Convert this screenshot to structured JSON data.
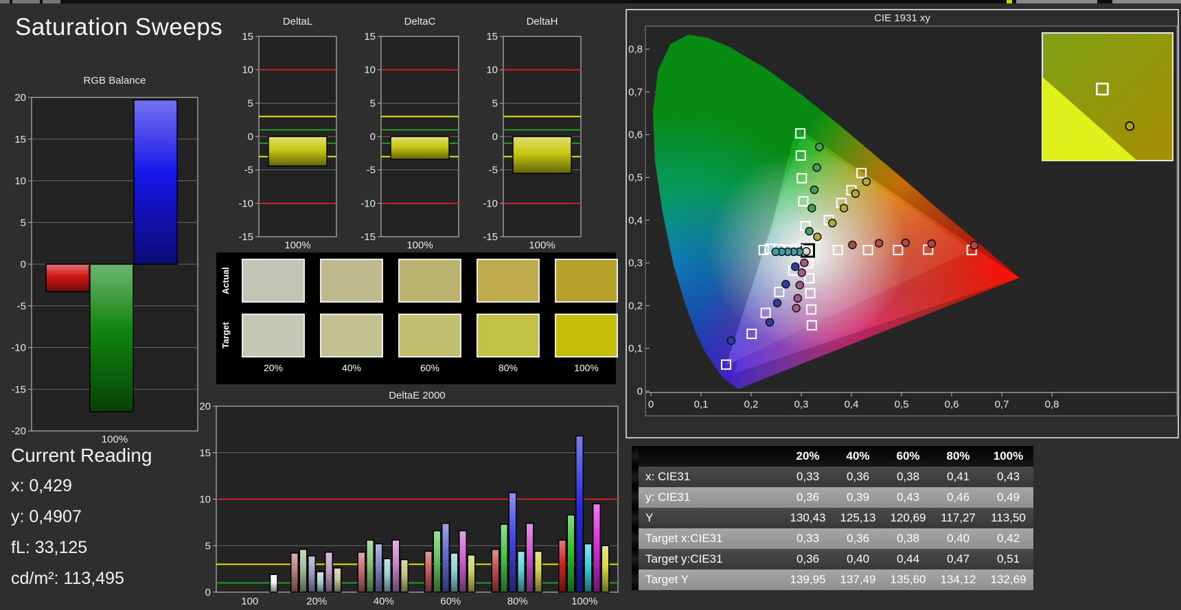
{
  "page": {
    "title": "Saturation Sweeps"
  },
  "current_reading": {
    "title": "Current Reading",
    "lines": [
      "x: 0,429",
      "y: 0,4907",
      "fL: 33,125",
      "cd/m²: 113,495"
    ]
  },
  "swatches": {
    "row_labels": [
      "Actual",
      "Target"
    ],
    "col_labels": [
      "20%",
      "40%",
      "60%",
      "80%",
      "100%"
    ],
    "actual": [
      "#c4c4b4",
      "#bfba8e",
      "#bdb370",
      "#bdab4c",
      "#b7a22c"
    ],
    "target": [
      "#c7c7b5",
      "#c2c190",
      "#c2bf6e",
      "#c2c144",
      "#c5be09"
    ]
  },
  "table": {
    "headers": [
      "20%",
      "40%",
      "60%",
      "80%",
      "100%"
    ],
    "rows": [
      {
        "label": "x: CIE31",
        "values": [
          "0,33",
          "0,36",
          "0,38",
          "0,41",
          "0,43"
        ]
      },
      {
        "label": "y: CIE31",
        "values": [
          "0,36",
          "0,39",
          "0,43",
          "0,46",
          "0,49"
        ]
      },
      {
        "label": "Y",
        "values": [
          "130,43",
          "125,13",
          "120,69",
          "117,27",
          "113,50"
        ]
      },
      {
        "label": "Target x:CIE31",
        "values": [
          "0,33",
          "0,36",
          "0,38",
          "0,40",
          "0,42"
        ]
      },
      {
        "label": "Target y:CIE31",
        "values": [
          "0,36",
          "0,40",
          "0,44",
          "0,47",
          "0,51"
        ]
      },
      {
        "label": "Target Y",
        "values": [
          "139,95",
          "137,49",
          "135,60",
          "134,12",
          "132,69"
        ]
      }
    ]
  },
  "chart_data": {
    "rgb_balance": {
      "type": "bar",
      "title": "RGB Balance",
      "category": "100%",
      "ylim": [
        -20,
        20
      ],
      "ystep": 5,
      "series": [
        {
          "name": "red",
          "value": -3.3,
          "color": "#d41414"
        },
        {
          "name": "green",
          "value": -17.7,
          "color": "#0f840f"
        },
        {
          "name": "blue",
          "value": 19.7,
          "color": "#1616e8"
        }
      ]
    },
    "delta_meters": {
      "type": "bar",
      "ylim": [
        -15,
        15
      ],
      "ystep": 5,
      "bar_color": "#c8c814",
      "ref_lines": [
        {
          "value": 10,
          "color": "#d42222"
        },
        {
          "value": -10,
          "color": "#d42222"
        },
        {
          "value": 3,
          "color": "#e6e600"
        },
        {
          "value": -3,
          "color": "#e6e600"
        },
        {
          "value": 1,
          "color": "#22a022"
        },
        {
          "value": -1,
          "color": "#22a022"
        }
      ],
      "charts": [
        {
          "title": "DeltaL",
          "category": "100%",
          "value": -4.4
        },
        {
          "title": "DeltaC",
          "category": "100%",
          "value": -3.4
        },
        {
          "title": "DeltaH",
          "category": "100%",
          "value": -5.5
        }
      ]
    },
    "deltae2000": {
      "type": "grouped-bar",
      "title": "DeltaE 2000",
      "ylim": [
        0,
        20
      ],
      "ystep": 5,
      "ref_lines": [
        {
          "value": 10,
          "color": "#d42222"
        },
        {
          "value": 3,
          "color": "#e6e600"
        },
        {
          "value": 1,
          "color": "#22a022"
        }
      ],
      "groups": [
        {
          "label": "100",
          "values": [
            1.9
          ],
          "colors": [
            "#f2f2f2"
          ]
        },
        {
          "label": "20%",
          "values": [
            4.2,
            4.6,
            3.9,
            2.2,
            4.3,
            2.6
          ],
          "colors": [
            "#b87e7e",
            "#a3bd94",
            "#9aa0cb",
            "#aed2d4",
            "#c09cc5",
            "#c6c69e"
          ]
        },
        {
          "label": "40%",
          "values": [
            4.3,
            5.6,
            5.2,
            3.6,
            5.6,
            3.5
          ],
          "colors": [
            "#c26f6f",
            "#84c276",
            "#7e86cc",
            "#9ed2d5",
            "#c987cd",
            "#c3c381"
          ]
        },
        {
          "label": "60%",
          "values": [
            4.4,
            6.6,
            7.4,
            4.2,
            6.6,
            4.0
          ],
          "colors": [
            "#c85d5d",
            "#64c364",
            "#6169d1",
            "#84d6d9",
            "#d064d4",
            "#cdcd6b"
          ]
        },
        {
          "label": "80%",
          "values": [
            4.6,
            7.3,
            10.7,
            4.4,
            7.4,
            4.4
          ],
          "colors": [
            "#c94b4b",
            "#47c947",
            "#4547d8",
            "#5cd3d8",
            "#d94bd9",
            "#d2d253"
          ]
        },
        {
          "label": "100%",
          "values": [
            5.6,
            8.3,
            16.8,
            5.2,
            9.5,
            5.0
          ],
          "colors": [
            "#cf2323",
            "#28c828",
            "#2a2ae0",
            "#3cd2da",
            "#dd2cdd",
            "#d8d838"
          ]
        }
      ]
    },
    "cie": {
      "type": "scatter",
      "title": "CIE 1931 xy",
      "xticks": [
        "0",
        "0,1",
        "0,2",
        "0,3",
        "0,4",
        "0,5",
        "0,6",
        "0,7",
        "0,8"
      ],
      "yticks": [
        "0",
        "0,1",
        "0,2",
        "0,3",
        "0,4",
        "0,5",
        "0,6",
        "0,7",
        "0,8"
      ],
      "xlim": [
        0,
        0.8
      ],
      "ylim": [
        0,
        0.85
      ],
      "gamut_native": [
        [
          0.29,
          0.617
        ],
        [
          0.734,
          0.265
        ],
        [
          0.167,
          0.042
        ]
      ],
      "gamut_ref": [
        [
          0.3,
          0.6
        ],
        [
          0.64,
          0.33
        ],
        [
          0.15,
          0.06
        ]
      ],
      "sweeps": [
        {
          "name": "white",
          "color": "#d9d9d9",
          "targets": [
            [
              0.313,
              0.329
            ]
          ],
          "measured": [
            [
              0.31,
              0.327
            ]
          ]
        },
        {
          "name": "red",
          "color": "#b04848",
          "targets": [
            [
              0.373,
              0.33
            ],
            [
              0.433,
              0.33
            ],
            [
              0.493,
              0.33
            ],
            [
              0.553,
              0.331
            ],
            [
              0.64,
              0.33
            ]
          ],
          "measured": [
            [
              0.402,
              0.342
            ],
            [
              0.455,
              0.346
            ],
            [
              0.508,
              0.347
            ],
            [
              0.56,
              0.345
            ],
            [
              0.645,
              0.341
            ]
          ]
        },
        {
          "name": "green",
          "color": "#44a258",
          "targets": [
            [
              0.308,
              0.386
            ],
            [
              0.304,
              0.444
            ],
            [
              0.301,
              0.498
            ],
            [
              0.299,
              0.551
            ],
            [
              0.298,
              0.603
            ]
          ],
          "measured": [
            [
              0.316,
              0.374
            ],
            [
              0.321,
              0.428
            ],
            [
              0.326,
              0.471
            ],
            [
              0.331,
              0.523
            ],
            [
              0.336,
              0.571
            ]
          ]
        },
        {
          "name": "blue",
          "color": "#2c3fa0",
          "targets": [
            [
              0.284,
              0.282
            ],
            [
              0.256,
              0.232
            ],
            [
              0.229,
              0.183
            ],
            [
              0.201,
              0.134
            ],
            [
              0.15,
              0.062
            ]
          ],
          "measured": [
            [
              0.288,
              0.291
            ],
            [
              0.269,
              0.25
            ],
            [
              0.252,
              0.206
            ],
            [
              0.237,
              0.161
            ],
            [
              0.16,
              0.118
            ]
          ]
        },
        {
          "name": "cyan",
          "color": "#3f9fa6",
          "targets": [
            [
              0.294,
              0.331
            ],
            [
              0.275,
              0.331
            ],
            [
              0.256,
              0.332
            ],
            [
              0.237,
              0.333
            ],
            [
              0.225,
              0.33
            ]
          ],
          "measured": [
            [
              0.296,
              0.326
            ],
            [
              0.285,
              0.326
            ],
            [
              0.273,
              0.326
            ],
            [
              0.261,
              0.326
            ],
            [
              0.249,
              0.326
            ]
          ]
        },
        {
          "name": "magenta",
          "color": "#a65a88",
          "targets": [
            [
              0.314,
              0.299
            ],
            [
              0.316,
              0.264
            ],
            [
              0.318,
              0.229
            ],
            [
              0.32,
              0.191
            ],
            [
              0.321,
              0.154
            ]
          ],
          "measured": [
            [
              0.306,
              0.3
            ],
            [
              0.301,
              0.277
            ],
            [
              0.297,
              0.248
            ],
            [
              0.293,
              0.217
            ],
            [
              0.29,
              0.194
            ]
          ]
        },
        {
          "name": "yellow",
          "color": "#b2a83e",
          "targets": [
            [
              0.33,
              0.36
            ],
            [
              0.355,
              0.4
            ],
            [
              0.38,
              0.44
            ],
            [
              0.4,
              0.47
            ],
            [
              0.42,
              0.51
            ]
          ],
          "measured": [
            [
              0.332,
              0.361
            ],
            [
              0.362,
              0.393
            ],
            [
              0.385,
              0.428
            ],
            [
              0.408,
              0.462
            ],
            [
              0.43,
              0.49
            ]
          ]
        }
      ],
      "inset": {
        "square": [
          0.46,
          0.44
        ],
        "circle": [
          0.67,
          0.73
        ]
      }
    }
  }
}
